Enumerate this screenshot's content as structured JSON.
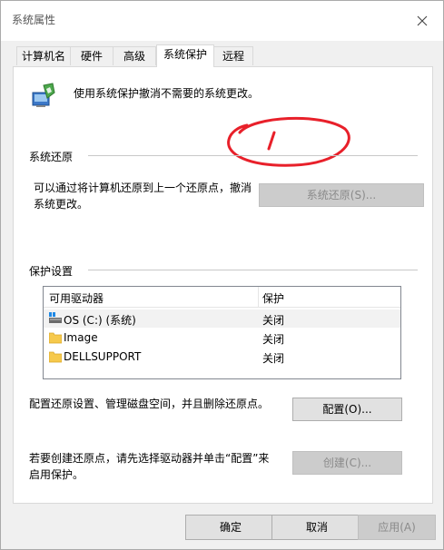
{
  "window": {
    "title": "系统属性"
  },
  "tabs": [
    {
      "label": "计算机名"
    },
    {
      "label": "硬件"
    },
    {
      "label": "高级"
    },
    {
      "label": "系统保护",
      "active": true
    },
    {
      "label": "远程"
    }
  ],
  "intro": "使用系统保护撤消不需要的系统更改。",
  "annotation": {
    "text": "1",
    "color": "#e8202a"
  },
  "restore": {
    "section_label": "系统还原",
    "description_line1": "可以通过将计算机还原到上一个还原点，撤消",
    "description_line2": "系统更改。",
    "button": "系统还原(S)..."
  },
  "protection": {
    "section_label": "保护设置",
    "columns": [
      "可用驱动器",
      "保护"
    ],
    "drives": [
      {
        "name": "OS (C:) (系统)",
        "protection": "关闭",
        "icon": "system-drive-icon"
      },
      {
        "name": "Image",
        "protection": "关闭",
        "icon": "folder-icon"
      },
      {
        "name": "DELLSUPPORT",
        "protection": "关闭",
        "icon": "folder-icon"
      }
    ],
    "configure_text": "配置还原设置、管理磁盘空间，并且删除还原点。",
    "configure_button": "配置(O)...",
    "create_text_line1": "若要创建还原点，请先选择驱动器并单击“配置”来",
    "create_text_line2": "启用保护。",
    "create_button": "创建(C)..."
  },
  "footer": {
    "ok": "确定",
    "cancel": "取消",
    "apply": "应用(A)"
  }
}
